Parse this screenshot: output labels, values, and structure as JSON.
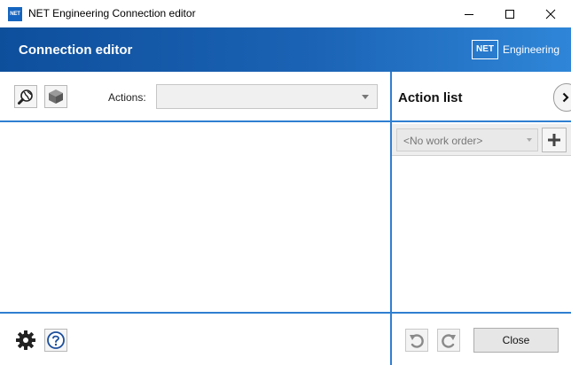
{
  "window": {
    "app_icon_text": "NET",
    "title": "NET Engineering Connection editor",
    "controls": [
      "minimize-icon",
      "maximize-icon",
      "close-icon"
    ]
  },
  "banner": {
    "title": "Connection editor",
    "logo_mark": "NET",
    "logo_text": "Engineering",
    "colors": {
      "start": "#0e4f9c",
      "end": "#2f86d8"
    }
  },
  "toolbar": {
    "tools": [
      "globe-search-icon",
      "cube-icon"
    ],
    "actions_label": "Actions:",
    "actions_value": ""
  },
  "action_list": {
    "title": "Action list",
    "expand_icon": "chevron-right-icon",
    "work_order_value": "<No work order>",
    "add_icon": "plus-icon"
  },
  "footer": {
    "left_icons": [
      "gear-icon",
      "help-icon"
    ],
    "history_icons": [
      "undo-icon",
      "redo-icon"
    ],
    "close_label": "Close"
  },
  "accent_color": "#2f7fd0"
}
